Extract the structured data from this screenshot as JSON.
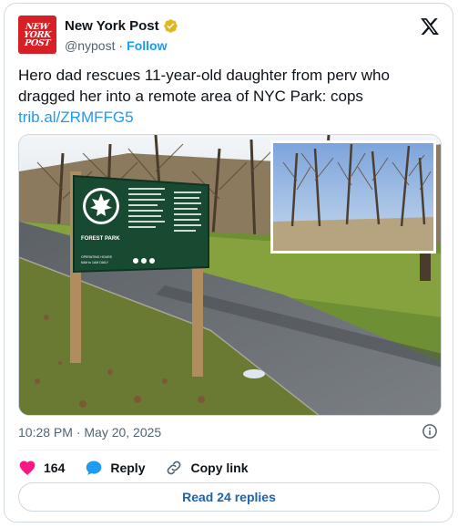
{
  "account": {
    "name": "New York Post",
    "handle": "@nypost",
    "separator": "·",
    "follow_label": "Follow",
    "logo_lines": [
      "NEW",
      "YORK",
      "POST"
    ]
  },
  "tweet": {
    "text": "Hero dad rescues 11-year-old daughter from perv who dragged her into a remote area of NYC Park: cops",
    "link": "trib.al/ZRMFFG5"
  },
  "media": {
    "sign_title": "FOREST PARK",
    "sign_footer_lines": [
      "OPERATING HOURS",
      "6AM to 1AM DAILY"
    ]
  },
  "meta": {
    "timestamp": "10:28 PM · May 20, 2025"
  },
  "actions": {
    "like_count": "164",
    "reply_label": "Reply",
    "copy_label": "Copy link"
  },
  "read_replies_label": "Read 24 replies",
  "colors": {
    "brand_red": "#d81f26",
    "link_blue": "#1d9bf0",
    "heart": "#f91880",
    "reply_blue": "#1d9bf0",
    "read_replies_text": "#1d63ad"
  },
  "icons": [
    "nypost-logo",
    "verified-badge-icon",
    "x-logo-icon",
    "info-icon",
    "heart-icon",
    "reply-bubble-icon",
    "link-icon"
  ]
}
